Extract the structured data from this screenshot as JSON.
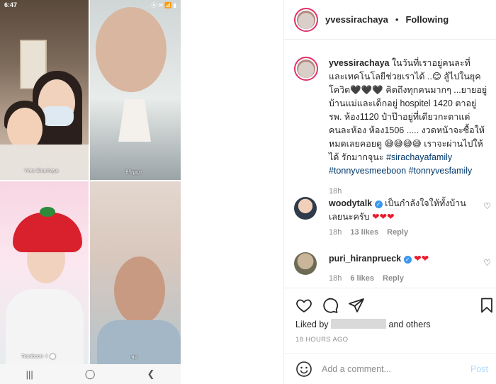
{
  "phone": {
    "status_time": "6:47",
    "status_icons": "⦿ ✉ 📶 ▮",
    "tiles": [
      {
        "label": "Yves Sirachaya"
      },
      {
        "label": "ธิรัญญา"
      },
      {
        "label": "Toonboon ✌ ⬤"
      },
      {
        "label": "พ่อ"
      }
    ],
    "nav": {
      "recent": "|||",
      "home": "◯",
      "back": "❮"
    }
  },
  "post": {
    "header": {
      "username": "yvessirachaya",
      "separator": "•",
      "follow_state": "Following"
    },
    "caption": {
      "username": "yvessirachaya",
      "text": "ในวันที่เราอยู่คนละที่ และเทคโนโลยีช่วยเราได้ ..😊 สู้ไปในยุคโควิด🖤🖤🖤 คิดถึงทุกคนมากๆ ...ยายอยู่บ้านแม่และเด็กอยู่ hospitel 1420 ตาอยู่รพ. ห้อง1120 ป๋าป๊าอยู่ที่เดียวกะตาแต่คนละห้อง ห้อง1506 ..... งวดหน้าจะซื้อให้หมดเลยคอยดู 😅😅😅😅 เราจะผ่านไปให้ได้ รักมากจุนะ",
      "hashtags": [
        "#sirachayafamily",
        "#tonnyvesmeeboon",
        "#tonnyvesfamily"
      ],
      "age": "18h"
    },
    "comments": [
      {
        "username": "woodytalk",
        "text": "เป็นกำลังใจให้ทั้งบ้านเลยนะครับ",
        "hearts": "❤❤❤",
        "age": "18h",
        "likes": "13 likes",
        "reply": "Reply"
      },
      {
        "username": "puri_hiranprueck",
        "text": "",
        "hearts": "❤❤",
        "age": "18h",
        "likes": "6 likes",
        "reply": "Reply"
      }
    ],
    "liked_by_prefix": "Liked by",
    "liked_by_suffix": "and others",
    "time_ago": "18 HOURS AGO",
    "add_comment": {
      "placeholder": "Add a comment...",
      "post_label": "Post"
    }
  }
}
